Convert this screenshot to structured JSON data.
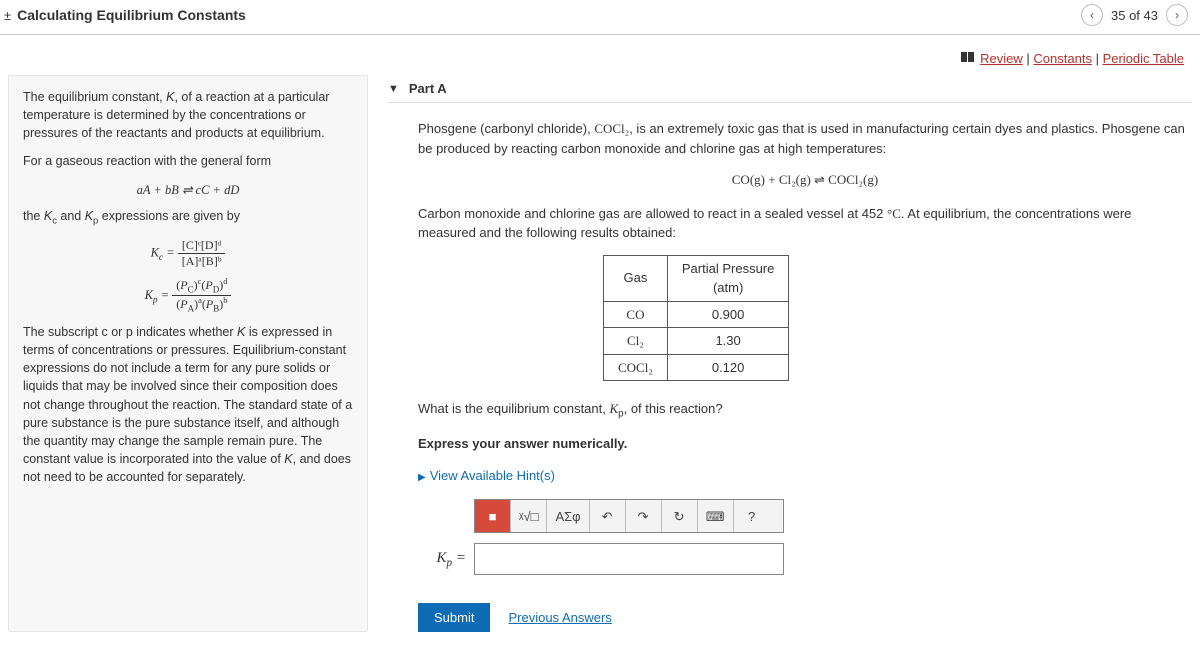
{
  "topbar": {
    "plusminus": "±",
    "title": "Calculating Equilibrium Constants",
    "page_indicator": "35 of 43"
  },
  "toplinks": {
    "review": "Review",
    "constants": "Constants",
    "periodic": "Periodic Table"
  },
  "left": {
    "p1": "The equilibrium constant, K, of a reaction at a particular temperature is determined by the concentrations or pressures of the reactants and products at equilibrium.",
    "p2": "For a gaseous reaction with the general form",
    "eq1": "aA + bB ⇌ cC + dD",
    "p3_a": "the ",
    "p3_b": " and ",
    "p3_c": " expressions are given by",
    "kc_label": "K",
    "kc_sub": "c",
    "kp_label": "K",
    "kp_sub": "p",
    "kc_num": "[C]ᶜ[D]ᵈ",
    "kc_den": "[A]ᵃ[B]ᵇ",
    "kp_num": "(P_C)ᶜ(P_D)ᵈ",
    "kp_den": "(P_A)ᵃ(P_B)ᵇ",
    "p4": "The subscript c or p indicates whether K is expressed in terms of concentrations or pressures. Equilibrium-constant expressions do not include a term for any pure solids or liquids that may be involved since their composition does not change throughout the reaction. The standard state of a pure substance is the pure substance itself, and although the quantity may change the sample remain pure. The constant value is incorporated into the value of K, and does not need to be accounted for separately."
  },
  "part": {
    "label": "Part A",
    "intro_a": "Phosgene (carbonyl chloride), ",
    "intro_b": ", is an extremely toxic gas that is used in manufacturing certain dyes and plastics. Phosgene can be produced by reacting carbon monoxide and chlorine gas at high temperatures:",
    "cocl2": "COCl₂",
    "reaction": "CO(g) + Cl₂(g) ⇌ COCl₂(g)",
    "mid_a": "Carbon monoxide and chlorine gas are allowed to react in a sealed vessel at 452 ",
    "mid_unit": "°C",
    "mid_b": ". At equilibrium, the concentrations were measured and the following results obtained:",
    "table": {
      "h1": "Gas",
      "h2a": "Partial Pressure",
      "h2b": "(atm)",
      "rows": [
        {
          "gas": "CO",
          "p": "0.900"
        },
        {
          "gas": "Cl₂",
          "p": "1.30"
        },
        {
          "gas": "COCl₂",
          "p": "0.120"
        }
      ]
    },
    "q_a": "What is the equilibrium constant, ",
    "q_b": ", of this reaction?",
    "kp": "Kₚ",
    "instr": "Express your answer numerically.",
    "hints": "View Available Hint(s)",
    "toolbar": {
      "active": "■",
      "sqrt": "ᵡ√□",
      "greek": "ΑΣφ",
      "undo": "↶",
      "redo": "↷",
      "reset": "↻",
      "keyboard": "⌨",
      "help": "?"
    },
    "answer_label": "Kₚ =",
    "submit": "Submit",
    "prev": "Previous Answers"
  },
  "chart_data": {
    "type": "table",
    "title": "Partial Pressure (atm)",
    "categories": [
      "CO",
      "Cl₂",
      "COCl₂"
    ],
    "values": [
      0.9,
      1.3,
      0.12
    ]
  }
}
